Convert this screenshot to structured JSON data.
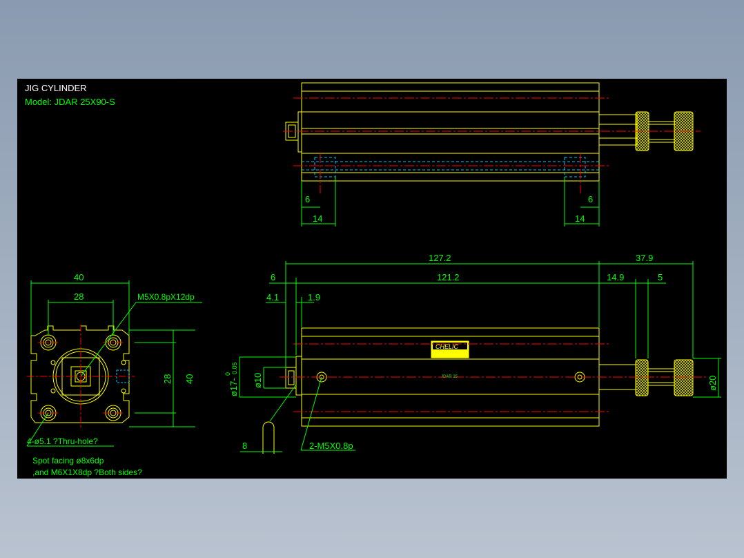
{
  "title": {
    "line1": "JIG CYLINDER",
    "line2": "Model:  JDAR  25X90-S"
  },
  "colors": {
    "background": "#000000",
    "outline": "#ffff00",
    "dimension": "#00ff00",
    "center_line": "#ff0000",
    "hidden_line": "#00c8ff",
    "window": "#96a5b9"
  },
  "top_view": {
    "dims": {
      "left_6": "6",
      "left_14": "14",
      "right_6": "6",
      "right_14": "14"
    }
  },
  "side_view": {
    "dims": {
      "d127_2": "127.2",
      "d37_9": "37.9",
      "d6": "6",
      "d121_2": "121.2",
      "d14_9": "14.9",
      "d5": "5",
      "d4_1": "4.1",
      "d1_9": "1.9",
      "d8": "8",
      "dia17_main": "ø17-",
      "dia17_tol_upper": "0",
      "dia17_tol_lower": "0.05",
      "dia10": "ø10",
      "dia20": "ø20"
    },
    "callout": "2-M5X0.8p",
    "label_brand": "CHELIC",
    "label_model": "JDAR 25"
  },
  "end_view": {
    "dims": {
      "w40": "40",
      "w28": "28",
      "h28": "28",
      "h40": "40"
    },
    "thread_callout": "M5X0.8pX12dp",
    "hole_note_1": "4-ø5.1 ?Thru-hole?",
    "hole_note_2": "Spot facing  ø8x6dp",
    "hole_note_3": ",and  M6X1X8dp ?Both sides?"
  }
}
